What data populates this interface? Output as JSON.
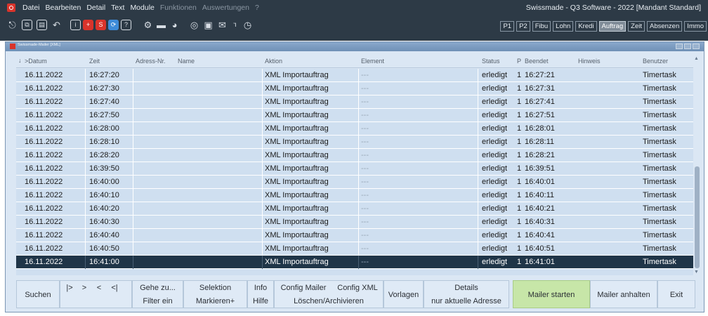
{
  "menubar": {
    "items": [
      {
        "label": "Datei",
        "enabled": true
      },
      {
        "label": "Bearbeiten",
        "enabled": true
      },
      {
        "label": "Detail",
        "enabled": true
      },
      {
        "label": "Text",
        "enabled": true
      },
      {
        "label": "Module",
        "enabled": true
      },
      {
        "label": "Funktionen",
        "enabled": false
      },
      {
        "label": "Auswertungen",
        "enabled": false
      },
      {
        "label": "?",
        "enabled": false
      }
    ],
    "app_title": "Swissmade - Q3 Software - 2022 [Mandant Standard]"
  },
  "toolbar": {
    "icons": [
      "exit-icon",
      "copy-icon",
      "paste-icon",
      "undo-icon",
      "info-icon",
      "add-icon",
      "save-icon",
      "refresh-icon",
      "help-icon",
      "settings-icon",
      "print-icon",
      "chart-icon",
      "preview-icon",
      "screen-icon",
      "mail-icon",
      "users-icon",
      "clock-icon"
    ]
  },
  "module_tabs": [
    {
      "label": "P1",
      "active": false
    },
    {
      "label": "P2",
      "active": false
    },
    {
      "label": "Fibu",
      "active": false
    },
    {
      "label": "Lohn",
      "active": false
    },
    {
      "label": "Kredi",
      "active": false
    },
    {
      "label": "Auftrag",
      "active": true
    },
    {
      "label": "Zeit",
      "active": false
    },
    {
      "label": "Absenzen",
      "active": false
    },
    {
      "label": "Immo",
      "active": false
    }
  ],
  "window": {
    "title": "Swissmade-Mailer [XML]"
  },
  "grid": {
    "columns": [
      "Datum",
      "Zeit",
      "Adress-Nr.",
      "Name",
      "Aktion",
      "Element",
      "Status",
      "P",
      "Beendet",
      "Hinweis",
      "Benutzer"
    ],
    "sort_marker": ">",
    "rows": [
      {
        "datum": "16.11.2022",
        "zeit": "16:27:20",
        "adr": "",
        "name": "",
        "aktion": "XML Importauftrag",
        "element": "---",
        "status": "erledigt",
        "p": "1",
        "beendet": "16:27:21",
        "hinweis": "",
        "benutzer": "Timertask",
        "selected": false
      },
      {
        "datum": "16.11.2022",
        "zeit": "16:27:30",
        "adr": "",
        "name": "",
        "aktion": "XML Importauftrag",
        "element": "---",
        "status": "erledigt",
        "p": "1",
        "beendet": "16:27:31",
        "hinweis": "",
        "benutzer": "Timertask",
        "selected": false
      },
      {
        "datum": "16.11.2022",
        "zeit": "16:27:40",
        "adr": "",
        "name": "",
        "aktion": "XML Importauftrag",
        "element": "---",
        "status": "erledigt",
        "p": "1",
        "beendet": "16:27:41",
        "hinweis": "",
        "benutzer": "Timertask",
        "selected": false
      },
      {
        "datum": "16.11.2022",
        "zeit": "16:27:50",
        "adr": "",
        "name": "",
        "aktion": "XML Importauftrag",
        "element": "---",
        "status": "erledigt",
        "p": "1",
        "beendet": "16:27:51",
        "hinweis": "",
        "benutzer": "Timertask",
        "selected": false
      },
      {
        "datum": "16.11.2022",
        "zeit": "16:28:00",
        "adr": "",
        "name": "",
        "aktion": "XML Importauftrag",
        "element": "---",
        "status": "erledigt",
        "p": "1",
        "beendet": "16:28:01",
        "hinweis": "",
        "benutzer": "Timertask",
        "selected": false
      },
      {
        "datum": "16.11.2022",
        "zeit": "16:28:10",
        "adr": "",
        "name": "",
        "aktion": "XML Importauftrag",
        "element": "---",
        "status": "erledigt",
        "p": "1",
        "beendet": "16:28:11",
        "hinweis": "",
        "benutzer": "Timertask",
        "selected": false
      },
      {
        "datum": "16.11.2022",
        "zeit": "16:28:20",
        "adr": "",
        "name": "",
        "aktion": "XML Importauftrag",
        "element": "---",
        "status": "erledigt",
        "p": "1",
        "beendet": "16:28:21",
        "hinweis": "",
        "benutzer": "Timertask",
        "selected": false
      },
      {
        "datum": "16.11.2022",
        "zeit": "16:39:50",
        "adr": "",
        "name": "",
        "aktion": "XML Importauftrag",
        "element": "---",
        "status": "erledigt",
        "p": "1",
        "beendet": "16:39:51",
        "hinweis": "",
        "benutzer": "Timertask",
        "selected": false
      },
      {
        "datum": "16.11.2022",
        "zeit": "16:40:00",
        "adr": "",
        "name": "",
        "aktion": "XML Importauftrag",
        "element": "---",
        "status": "erledigt",
        "p": "1",
        "beendet": "16:40:01",
        "hinweis": "",
        "benutzer": "Timertask",
        "selected": false
      },
      {
        "datum": "16.11.2022",
        "zeit": "16:40:10",
        "adr": "",
        "name": "",
        "aktion": "XML Importauftrag",
        "element": "---",
        "status": "erledigt",
        "p": "1",
        "beendet": "16:40:11",
        "hinweis": "",
        "benutzer": "Timertask",
        "selected": false
      },
      {
        "datum": "16.11.2022",
        "zeit": "16:40:20",
        "adr": "",
        "name": "",
        "aktion": "XML Importauftrag",
        "element": "---",
        "status": "erledigt",
        "p": "1",
        "beendet": "16:40:21",
        "hinweis": "",
        "benutzer": "Timertask",
        "selected": false
      },
      {
        "datum": "16.11.2022",
        "zeit": "16:40:30",
        "adr": "",
        "name": "",
        "aktion": "XML Importauftrag",
        "element": "---",
        "status": "erledigt",
        "p": "1",
        "beendet": "16:40:31",
        "hinweis": "",
        "benutzer": "Timertask",
        "selected": false
      },
      {
        "datum": "16.11.2022",
        "zeit": "16:40:40",
        "adr": "",
        "name": "",
        "aktion": "XML Importauftrag",
        "element": "---",
        "status": "erledigt",
        "p": "1",
        "beendet": "16:40:41",
        "hinweis": "",
        "benutzer": "Timertask",
        "selected": false
      },
      {
        "datum": "16.11.2022",
        "zeit": "16:40:50",
        "adr": "",
        "name": "",
        "aktion": "XML Importauftrag",
        "element": "---",
        "status": "erledigt",
        "p": "1",
        "beendet": "16:40:51",
        "hinweis": "",
        "benutzer": "Timertask",
        "selected": false
      },
      {
        "datum": "16.11.2022",
        "zeit": "16:41:00",
        "adr": "",
        "name": "",
        "aktion": "XML Importauftrag",
        "element": "---",
        "status": "erledigt",
        "p": "1",
        "beendet": "16:41:01",
        "hinweis": "",
        "benutzer": "Timertask",
        "selected": true
      }
    ]
  },
  "actions": {
    "suchen": "Suchen",
    "nav": [
      "|>",
      ">",
      "<",
      "<|"
    ],
    "gehe_zu": "Gehe zu...",
    "filter_ein": "Filter ein",
    "selektion": "Selektion",
    "markieren": "Markieren+",
    "info": "Info",
    "hilfe": "Hilfe",
    "config_mailer": "Config Mailer",
    "config_xml": "Config XML",
    "loeschen": "Löschen/Archivieren",
    "vorlagen": "Vorlagen",
    "details": "Details",
    "nur_aktuelle": "nur aktuelle Adresse",
    "mailer_starten": "Mailer starten",
    "mailer_anhalten": "Mailer anhalten",
    "exit": "Exit"
  },
  "colors": {
    "frame": "#2d3a46",
    "row_bg": "#cfdff0",
    "selected_row": "#1f3548",
    "start_button": "#c7e6a8"
  }
}
